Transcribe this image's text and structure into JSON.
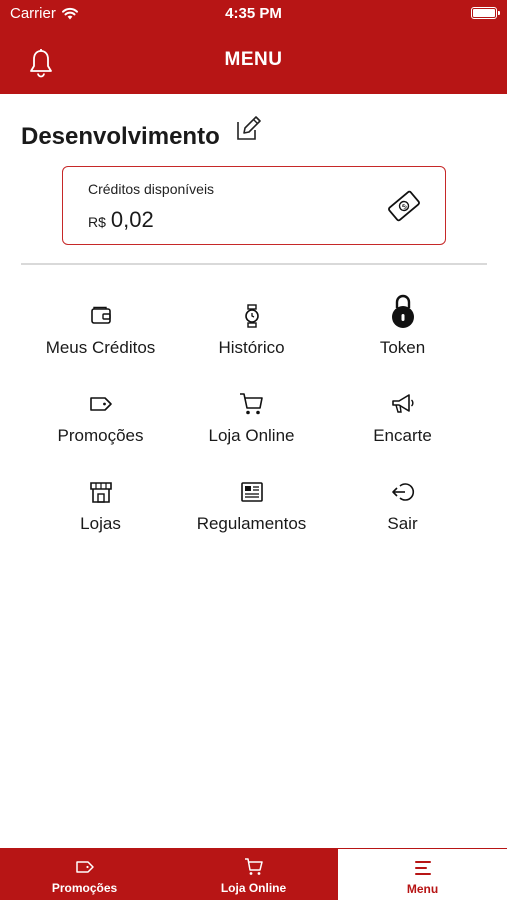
{
  "status_bar": {
    "carrier": "Carrier",
    "time": "4:35 PM"
  },
  "header": {
    "title": "MENU"
  },
  "user": {
    "name": "Desenvolvimento"
  },
  "credits": {
    "label": "Créditos disponíveis",
    "currency": "R$",
    "amount": "0,02"
  },
  "menu": {
    "items": [
      {
        "label": "Meus Créditos",
        "icon": "wallet-icon"
      },
      {
        "label": "Histórico",
        "icon": "watch-icon"
      },
      {
        "label": "Token",
        "icon": "lock-icon"
      },
      {
        "label": "Promoções",
        "icon": "tag-icon"
      },
      {
        "label": "Loja Online",
        "icon": "cart-icon"
      },
      {
        "label": "Encarte",
        "icon": "megaphone-icon"
      },
      {
        "label": "Lojas",
        "icon": "store-icon"
      },
      {
        "label": "Regulamentos",
        "icon": "newspaper-icon"
      },
      {
        "label": "Sair",
        "icon": "logout-icon"
      }
    ]
  },
  "tab_bar": {
    "tabs": [
      {
        "label": "Promoções",
        "icon": "tag-icon",
        "active": false
      },
      {
        "label": "Loja Online",
        "icon": "cart-icon",
        "active": false
      },
      {
        "label": "Menu",
        "icon": "menu-icon",
        "active": true
      }
    ]
  },
  "colors": {
    "brand": "#b71515",
    "card_border": "#c62828",
    "divider": "#d9d9d9"
  }
}
